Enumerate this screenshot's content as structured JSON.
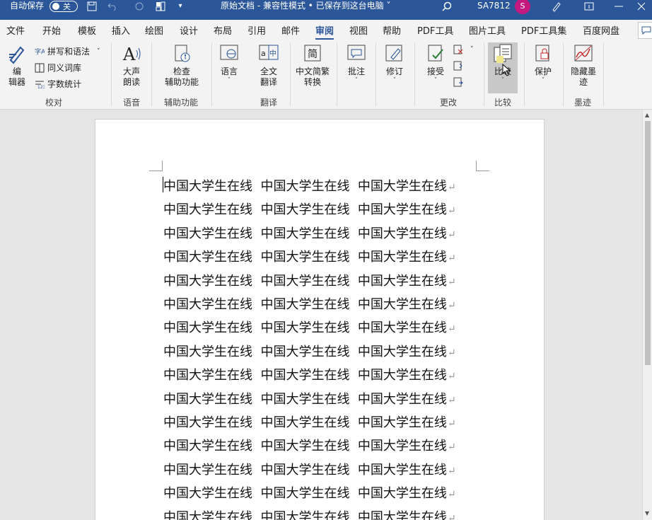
{
  "titlebar": {
    "autosave_label": "自动保存",
    "autosave_state": "关",
    "title": "原始文档  -  兼容性模式 • 已保存到这台电脑",
    "user": "SA7812",
    "avatar_initial": "S"
  },
  "tabs": [
    "文件",
    "开始",
    "模板",
    "插入",
    "绘图",
    "设计",
    "布局",
    "引用",
    "邮件",
    "审阅",
    "视图",
    "帮助",
    "PDF工具",
    "图片工具",
    "PDF工具集",
    "百度网盘"
  ],
  "active_tab": "审阅",
  "ribbon": {
    "proofing": {
      "editor": "编\n辑器",
      "spelling": "拼写和语法",
      "thesaurus": "同义词库",
      "wordcount": "字数统计",
      "group": "校对"
    },
    "speech": {
      "read_aloud": "大声\n朗读",
      "group": "语音"
    },
    "accessibility": {
      "check": "检查\n辅助功能",
      "group": "辅助功能"
    },
    "language": {
      "language": "语言",
      "translate": "全文\n翻译",
      "group": "翻译"
    },
    "chinese": {
      "convert": "中文简繁\n转换"
    },
    "comments": {
      "comment": "批注"
    },
    "tracking": {
      "track": "修订"
    },
    "changes": {
      "accept": "接受",
      "group": "更改"
    },
    "compare": {
      "compare": "比较",
      "group": "比较"
    },
    "protect": {
      "protect": "保护"
    },
    "ink": {
      "hide": "隐藏墨\n迹",
      "group": "墨迹"
    }
  },
  "document": {
    "lines": [
      "中国大学生在线  中国大学生在线  中国大学生在线",
      "中国大学生在线  中国大学生在线  中国大学生在线",
      "中国大学生在线  中国大学生在线  中国大学生在线",
      "中国大学生在线  中国大学生在线  中国大学生在线",
      "中国大学生在线  中国大学生在线  中国大学生在线",
      "中国大学生在线  中国大学生在线  中国大学生在线",
      "中国大学生在线  中国大学生在线  中国大学生在线",
      "中国大学生在线  中国大学生在线  中国大学生在线",
      "中国大学生在线  中国大学生在线  中国大学生在线",
      "中国大学生在线  中国大学生在线  中国大学生在线",
      "中国大学生在线  中国大学生在线  中国大学生在线",
      "中国大学生在线  中国大学生在线  中国大学生在线",
      "中国大学生在线  中国大学生在线  中国大学生在线",
      "中国大学生在线  中国大学生在线  中国大学生在线",
      "中国大学生在线  中国大学生在线  中国大学生在线"
    ],
    "paragraph_mark": "↵"
  },
  "colors": {
    "accent": "#2b579a",
    "avatar": "#c4197e"
  }
}
